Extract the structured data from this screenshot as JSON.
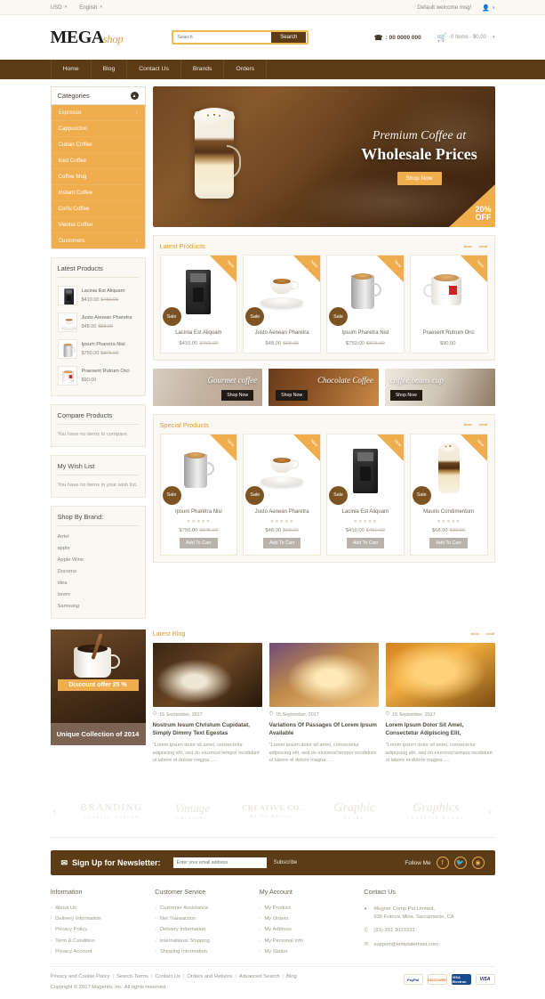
{
  "topbar": {
    "currency": "USD",
    "language": "English",
    "welcome": "Default welcome msg!",
    "account_icon": "user-icon"
  },
  "header": {
    "logo_main": "MEGA",
    "logo_accent": "shop",
    "search_placeholder": "Search",
    "search_button": "Search",
    "phone": ": 00 0000 000",
    "cart_text": "0 Items - $0.00"
  },
  "nav": {
    "items": [
      "Home",
      "Blog",
      "Contact Us",
      "Brands",
      "Orders"
    ]
  },
  "sidebar": {
    "categories_title": "Categories",
    "categories": [
      {
        "label": "Espresso",
        "has_children": true
      },
      {
        "label": "Cappuccino",
        "has_children": false
      },
      {
        "label": "Cuban Coffee",
        "has_children": false
      },
      {
        "label": "Iced Coffee",
        "has_children": false
      },
      {
        "label": "Coffee Mug",
        "has_children": false
      },
      {
        "label": "Instant Coffee",
        "has_children": false
      },
      {
        "label": "Corfu Coffee",
        "has_children": false
      },
      {
        "label": "Vienna Coffee",
        "has_children": false
      },
      {
        "label": "Customers",
        "has_children": true
      }
    ],
    "latest_title": "Latest Products",
    "latest_products": [
      {
        "name": "Lacinia Est Aliquam",
        "price": "$410.00",
        "old_price": "$450.00",
        "art": "machine"
      },
      {
        "name": "Justo Aenean Pharetra",
        "price": "$48.00",
        "old_price": "$58.00",
        "art": "saucer"
      },
      {
        "name": "Ipsum Pharetra Nisl",
        "price": "$750.00",
        "old_price": "$875.00",
        "art": "mug-grey"
      },
      {
        "name": "Praesent Rutrum Orci",
        "price": "$90.00",
        "old_price": "",
        "art": "mug-white"
      }
    ],
    "compare_title": "Compare Products",
    "compare_empty": "You have no items to compare.",
    "wishlist_title": "My Wish List",
    "wishlist_empty": "You have no items in your wish list.",
    "brand_title": "Shop By Brand:",
    "brands": [
      "Airtel",
      "apple",
      "Apple Wine",
      "Docomo",
      "idea",
      "lorem",
      "Samsung"
    ]
  },
  "hero": {
    "line1": "Premium Coffee at",
    "line2": "Wholesale Prices",
    "button": "Shop Now",
    "badge_pct": "20%",
    "badge_off": "OFF"
  },
  "latest_section": {
    "title": "Latest Products",
    "prev_icon": "arrow-left-icon",
    "next_icon": "arrow-right-icon",
    "products": [
      {
        "name": "Lacinia Est Aliquam",
        "price": "$410.00",
        "old_price": "$450.00",
        "ribbon": "New",
        "sale": "Sale",
        "art": "machine"
      },
      {
        "name": "Justo Aenean Pharetra",
        "price": "$48.00",
        "old_price": "$58.00",
        "ribbon": "New",
        "sale": "Sale",
        "art": "saucer"
      },
      {
        "name": "Ipsum Pharetra Nisl",
        "price": "$750.00",
        "old_price": "$875.00",
        "ribbon": "New",
        "sale": "Sale",
        "art": "mug-grey"
      },
      {
        "name": "Praesent Rutrum Orci",
        "price": "$90.00",
        "old_price": "",
        "ribbon": "New",
        "sale": "",
        "art": "mug-white"
      }
    ]
  },
  "promos": [
    {
      "title": "Gourmet coffee",
      "button": "Shop Now"
    },
    {
      "title": "Chocolate Coffee",
      "button": "Shop Now"
    },
    {
      "title": "coffee beans cup",
      "button": "Shop Now"
    }
  ],
  "special_section": {
    "title": "Special Products",
    "prev_icon": "arrow-left-icon",
    "next_icon": "arrow-right-icon",
    "add_to_cart": "Add To Cart",
    "stars": "★★★★★",
    "products": [
      {
        "name": "Ipsum Pharetra Nisl",
        "price": "$750.00",
        "old_price": "$875.00",
        "ribbon": "New",
        "sale": "Sale",
        "art": "mug-grey"
      },
      {
        "name": "Justo Aenean Pharetra",
        "price": "$48.00",
        "old_price": "$58.00",
        "ribbon": "New",
        "sale": "Sale",
        "art": "saucer"
      },
      {
        "name": "Lacinia Est Aliquam",
        "price": "$410.00",
        "old_price": "$450.00",
        "ribbon": "New",
        "sale": "Sale",
        "art": "machine"
      },
      {
        "name": "Mauris Condimentum",
        "price": "$68.00",
        "old_price": "$88.00",
        "ribbon": "New",
        "sale": "Sale",
        "art": "latte"
      }
    ]
  },
  "discount_banner": {
    "label": "Discount offer 25 %",
    "footer": "Unique Collection of 2014"
  },
  "blog": {
    "title": "Latest Blog",
    "prev_icon": "arrow-left-icon",
    "next_icon": "arrow-right-icon",
    "posts": [
      {
        "date": "15 September, 2017",
        "title": "Nostrum Iesum Christum Cupidatat, Simply Dimmy Text Egestas",
        "excerpt": "\"Lorem ipsum dolor sit amet, consectetur adipiscing elit, sed do eiusmod tempor incididunt ut labore et dolore magna ...."
      },
      {
        "date": "15 September, 2017",
        "title": "Variations Of Passages Of Lorem Ipsum Available",
        "excerpt": "\"Lorem ipsum dolor sit amet, consectetur adipiscing elit, sed do eiusmod tempor incididunt ut labore et dolore magna ...."
      },
      {
        "date": "15 September, 2017",
        "title": "Lorem Ipsum Dolor Sit Amet, Consectetur Adipiscing Elit,",
        "excerpt": "\"Lorem ipsum dolor sit amet, consectetur adipiscing elit, sed do eiusmod tempor incididunt ut labore et dolore magna ...."
      }
    ]
  },
  "brand_carousel": {
    "prev_icon": "chevron-left-icon",
    "next_icon": "chevron-right-icon",
    "logos": [
      {
        "name": "BRANDING",
        "sub": "CLASSIC DESIGN"
      },
      {
        "name": "Vintage",
        "sub": "ORIGINAL"
      },
      {
        "name": "CREATIVE CO.",
        "sub": "RETRO DESIGN"
      },
      {
        "name": "Graphic",
        "sub": "RETRO"
      },
      {
        "name": "Graphics",
        "sub": "CREATIVE WORKS"
      }
    ]
  },
  "newsletter": {
    "icon": "envelope-icon",
    "label": "Sign Up for Newsletter:",
    "placeholder": "Enter your email address",
    "button": "Subscribe",
    "follow_label": "Follow Me",
    "socials": [
      "facebook-icon",
      "twitter-icon",
      "rss-icon"
    ]
  },
  "footer": {
    "columns": [
      {
        "title": "Information",
        "links": [
          "About Us",
          "Delivery Information",
          "Privacy Policy",
          "Term & Condition",
          "Privacy Account"
        ]
      },
      {
        "title": "Customer Service",
        "links": [
          "Customer Assistance",
          "Net Transaction",
          "Delivery Information",
          "International Shipping",
          "Shipping Information"
        ]
      },
      {
        "title": "My Account",
        "links": [
          "My Product",
          "My Orders",
          "My Address",
          "My Personal Info",
          "My Status"
        ]
      }
    ],
    "contact": {
      "title": "Contact Us",
      "address_line1": "Megnor Comp Pvt Limited,",
      "address_line2": "930 Francis Mine, Sacramento, CA",
      "phone": "(91)-261 3023333",
      "email": "support@templatemela.com",
      "address_icon": "map-pin-icon",
      "phone_icon": "phone-icon",
      "email_icon": "mail-icon"
    }
  },
  "bottom": {
    "links": [
      "Privacy and Cookie Policy",
      "Search Terms",
      "Contact Us",
      "Orders and Returns",
      "Advanced Search",
      "Blog"
    ],
    "copyright": "Copyright © 2017 Magento, Inc. All rights reserved.",
    "payments": [
      "PayPal",
      "DISCOVER",
      "VISA Electron",
      "VISA"
    ]
  },
  "colors": {
    "brand_brown": "#5b3c17",
    "accent_orange": "#f0ad4e",
    "panel_bg": "#faf8f2"
  }
}
